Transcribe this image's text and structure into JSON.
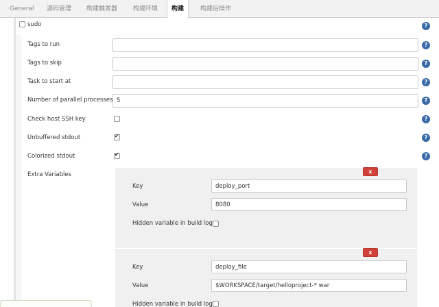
{
  "tabs": [
    "General",
    "源码管理",
    "构建触发器",
    "构建环境",
    "构建",
    "构建后操作"
  ],
  "active_tab": "构建",
  "sudo": {
    "label": "sudo",
    "checked": false
  },
  "fields": {
    "tags_to_run": {
      "label": "Tags to run",
      "value": ""
    },
    "tags_to_skip": {
      "label": "Tags to skip",
      "value": ""
    },
    "task_to_start_at": {
      "label": "Task to start at",
      "value": ""
    },
    "parallel_processes": {
      "label": "Number of parallel processes",
      "value": "5"
    }
  },
  "checkboxes": {
    "check_host_ssh_key": {
      "label": "Check host SSH key",
      "checked": false
    },
    "unbuffered_stdout": {
      "label": "Unbuffered stdout",
      "checked": true
    },
    "colorized_stdout": {
      "label": "Colorized stdout",
      "checked": true
    }
  },
  "extra_variables": {
    "label": "Extra Variables",
    "delete_label": "x",
    "key_label": "Key",
    "value_label": "Value",
    "hidden_label": "Hidden variable in build log",
    "items": [
      {
        "key": "deploy_port",
        "value": "8080",
        "hidden": false
      },
      {
        "key": "deploy_file",
        "value": "$WORKSPACE/target/helloproject-* war",
        "hidden": false
      }
    ]
  },
  "help_glyph": "?",
  "colors": {
    "help": "#3a6aa8",
    "delete_button": "#d2403a",
    "repeat_bg": "#f0f0f0"
  }
}
